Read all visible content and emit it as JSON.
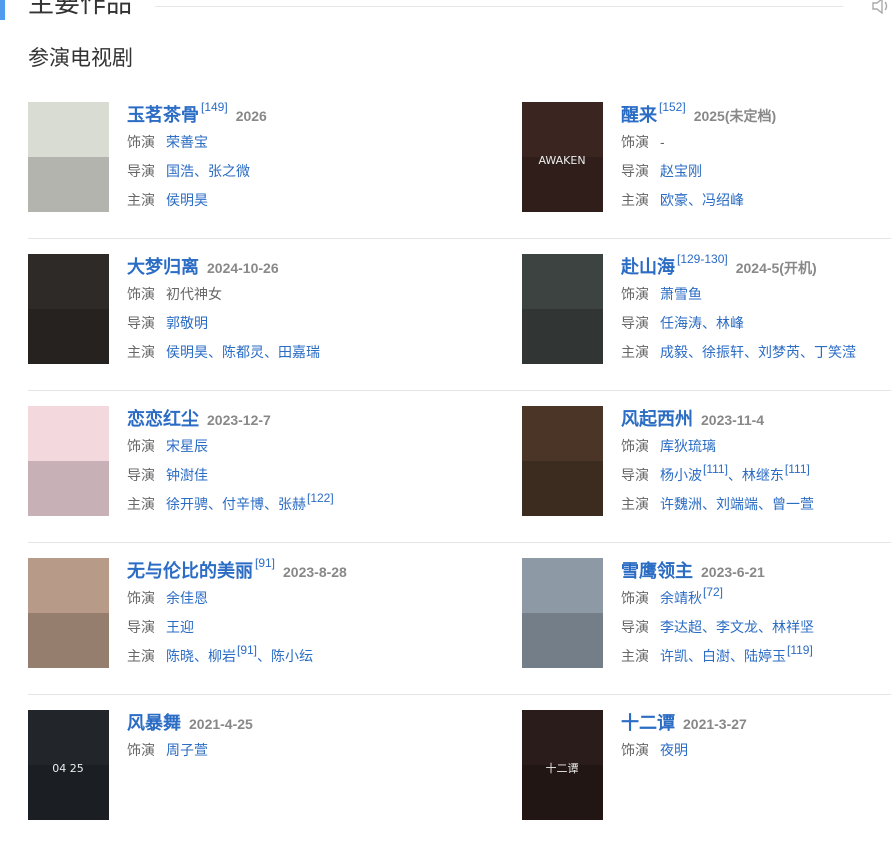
{
  "section": {
    "title": "主要作品",
    "subtitle": "参演电视剧"
  },
  "labels": {
    "role": "饰演",
    "director": "导演",
    "starring": "主演"
  },
  "works": [
    {
      "title": "玉茗茶骨",
      "ref": "[149]",
      "date": "2026",
      "role": [
        "荣善宝"
      ],
      "director": [
        "国浩",
        "张之微"
      ],
      "starring": [
        "侯明昊"
      ],
      "poster_color": "#d9dcd3"
    },
    {
      "title": "醒来",
      "ref": "[152]",
      "date": "2025(未定档)",
      "role_plain": "-",
      "director": [
        "赵宝刚"
      ],
      "starring": [
        "欧豪",
        "冯绍峰"
      ],
      "poster_color": "#3a2520",
      "poster_text": "AWAKEN"
    },
    {
      "title": "大梦归离",
      "ref": "",
      "date": "2024-10-26",
      "role_plain": "初代神女",
      "director": [
        "郭敬明"
      ],
      "starring": [
        "侯明昊",
        "陈都灵",
        "田嘉瑞"
      ],
      "poster_color": "#2e2a28"
    },
    {
      "title": "赴山海",
      "ref": "[129-130]",
      "date": "2024-5(开机)",
      "role": [
        "萧雪鱼"
      ],
      "director": [
        "任海涛",
        "林峰"
      ],
      "starring": [
        "成毅",
        "徐振轩",
        "刘梦芮",
        "丁笑滢"
      ],
      "poster_color": "#3c4341"
    },
    {
      "title": "恋恋红尘",
      "ref": "",
      "date": "2023-12-7",
      "role": [
        "宋星辰"
      ],
      "director": [
        "钟澍佳"
      ],
      "starring": [
        "徐开骋",
        "付辛博",
        "张赫"
      ],
      "starring_ref": "[122]",
      "poster_color": "#f3d8de"
    },
    {
      "title": "风起西州",
      "ref": "",
      "date": "2023-11-4",
      "role": [
        "库狄琉璃"
      ],
      "director": [
        "杨小波",
        "林继东"
      ],
      "director_refs": [
        "[111]",
        "[111]"
      ],
      "starring": [
        "许魏洲",
        "刘端端",
        "曾一萱"
      ],
      "poster_color": "#4a3527"
    },
    {
      "title": "无与伦比的美丽",
      "ref": "[91]",
      "date": "2023-8-28",
      "role": [
        "余佳恩"
      ],
      "director": [
        "王迎"
      ],
      "starring": [
        "陈晓",
        "柳岩",
        "陈小纭"
      ],
      "starring_ref_after": "[91]",
      "poster_color": "#b79a88"
    },
    {
      "title": "雪鹰领主",
      "ref": "",
      "date": "2023-6-21",
      "role": [
        "余靖秋"
      ],
      "role_ref": "[72]",
      "director": [
        "李达超",
        "李文龙",
        "林祥坚"
      ],
      "starring": [
        "许凯",
        "白澍",
        "陆婷玉"
      ],
      "starring_ref": "[119]",
      "poster_color": "#8d9aa6"
    },
    {
      "title": "风暴舞",
      "ref": "",
      "date": "2021-4-25",
      "role": [
        "周子萱"
      ],
      "poster_color": "#22262b",
      "poster_text": "04 25"
    },
    {
      "title": "十二谭",
      "ref": "",
      "date": "2021-3-27",
      "role": [
        "夜明"
      ],
      "poster_color": "#2a1c1a",
      "poster_text": "十二谭"
    }
  ]
}
